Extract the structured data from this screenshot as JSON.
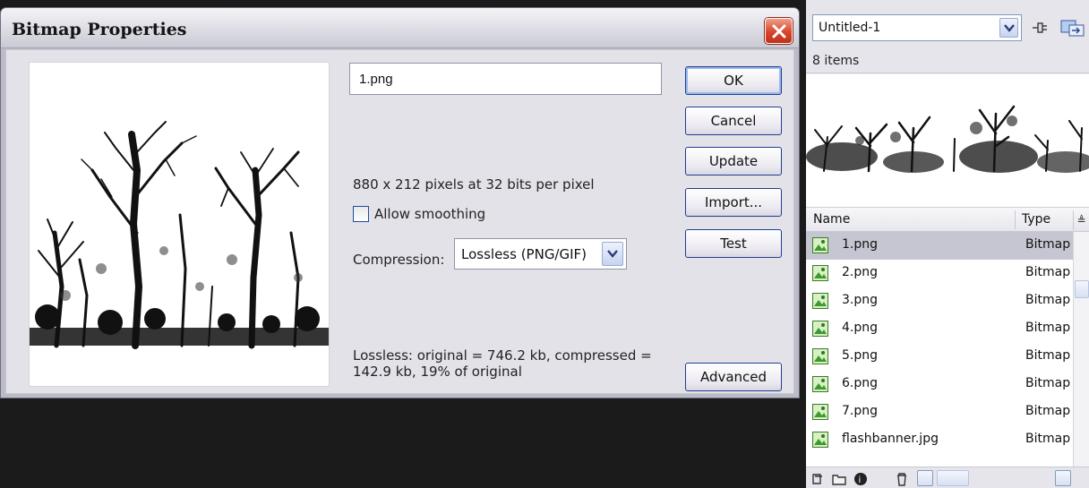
{
  "dialog": {
    "title": "Bitmap Properties",
    "file_name": "1.png",
    "dimensions_text": "880 x 212 pixels at 32 bits per pixel",
    "allow_smoothing_label": "Allow smoothing",
    "allow_smoothing_checked": false,
    "compression_label": "Compression:",
    "compression_value": "Lossless (PNG/GIF)",
    "summary_text": "Lossless: original = 746.2 kb, compressed = 142.9 kb, 19% of original",
    "buttons": {
      "ok": "OK",
      "cancel": "Cancel",
      "update": "Update",
      "import": "Import...",
      "test": "Test",
      "advanced": "Advanced"
    },
    "colors": {
      "close_button": "#d8452a",
      "button_border": "#1f3f8f",
      "client_bg": "#e3e2e9"
    }
  },
  "library": {
    "document": "Untitled-1",
    "item_count": "8 items",
    "columns": {
      "name": "Name",
      "type": "Type"
    },
    "items": [
      {
        "name": "1.png",
        "type": "Bitmap",
        "selected": true
      },
      {
        "name": "2.png",
        "type": "Bitmap"
      },
      {
        "name": "3.png",
        "type": "Bitmap"
      },
      {
        "name": "4.png",
        "type": "Bitmap"
      },
      {
        "name": "5.png",
        "type": "Bitmap"
      },
      {
        "name": "6.png",
        "type": "Bitmap"
      },
      {
        "name": "7.png",
        "type": "Bitmap"
      },
      {
        "name": "flashbanner.jpg",
        "type": "Bitmap"
      }
    ],
    "icons": [
      "pin-icon",
      "new-library-panel-icon",
      "bitmap-icon",
      "new-symbol-icon",
      "new-folder-icon",
      "properties-icon",
      "delete-icon"
    ]
  }
}
